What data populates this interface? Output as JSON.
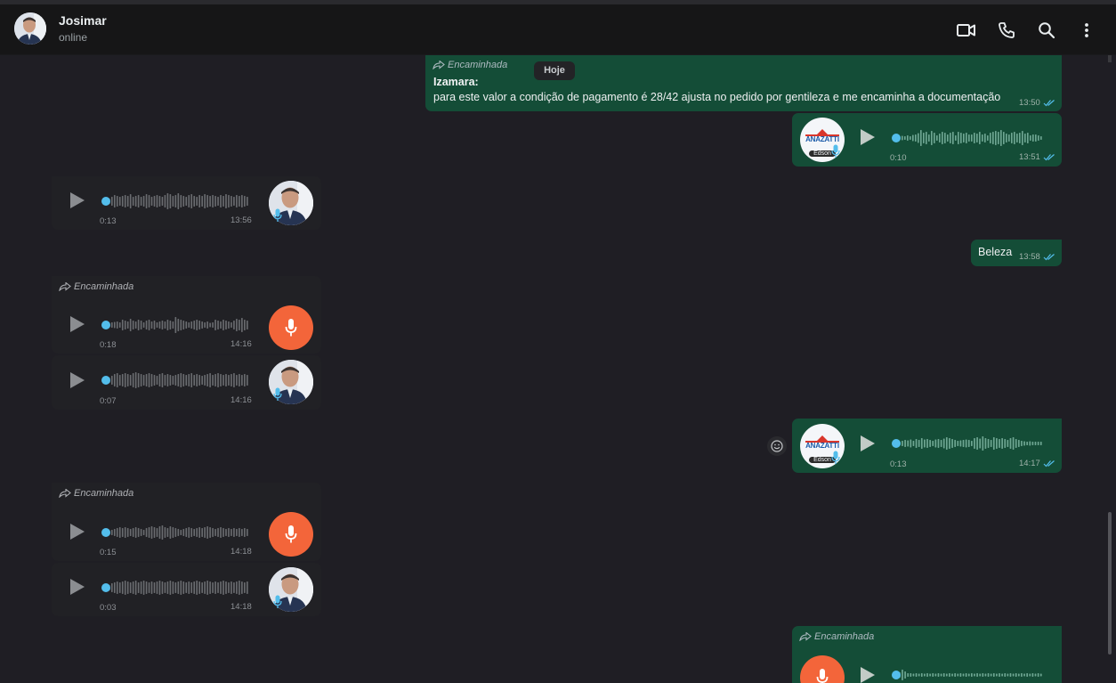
{
  "header": {
    "name": "Josimar",
    "status": "online",
    "icons": [
      "video-call-icon",
      "voice-call-icon",
      "search-icon",
      "menu-icon"
    ]
  },
  "date_divider": "Hoje",
  "forwarded_label": "Encaminhada",
  "messages": [
    {
      "id": "m1",
      "direction": "out",
      "type": "text",
      "forwarded": true,
      "sender": "Izamara:",
      "text": "para este valor a condição de pagamento é 28/42 ajusta no pedido por gentileza e me encaminha a documentação",
      "time": "13:50",
      "read": true
    },
    {
      "id": "m2",
      "direction": "out",
      "type": "audio",
      "duration": "0:10",
      "time": "13:51",
      "avatar_label": "ANAZATTI",
      "avatar_sub": "Edson",
      "read": true
    },
    {
      "id": "m3",
      "direction": "in",
      "type": "audio",
      "duration": "0:13",
      "time": "13:56"
    },
    {
      "id": "m4",
      "direction": "out",
      "type": "text",
      "text": "Beleza",
      "time": "13:58",
      "read": true
    },
    {
      "id": "m5",
      "direction": "in",
      "type": "audio",
      "forwarded": true,
      "duration": "0:18",
      "time": "14:16"
    },
    {
      "id": "m6",
      "direction": "in",
      "type": "audio",
      "duration": "0:07",
      "time": "14:16"
    },
    {
      "id": "m7",
      "direction": "out",
      "type": "audio",
      "duration": "0:13",
      "time": "14:17",
      "avatar_label": "ANAZATTI",
      "avatar_sub": "Edson",
      "read": true
    },
    {
      "id": "m8",
      "direction": "in",
      "type": "audio",
      "forwarded": true,
      "duration": "0:15",
      "time": "14:18"
    },
    {
      "id": "m9",
      "direction": "in",
      "type": "audio",
      "duration": "0:03",
      "time": "14:18"
    },
    {
      "id": "m10",
      "direction": "out",
      "type": "audio",
      "forwarded": true
    }
  ],
  "colors": {
    "outgoing_bubble": "#144d37",
    "incoming_bubble": "#212125",
    "mic_button": "#f3653a",
    "progress_dot": "#53bdeb",
    "read_ticks": "#53bdeb"
  }
}
